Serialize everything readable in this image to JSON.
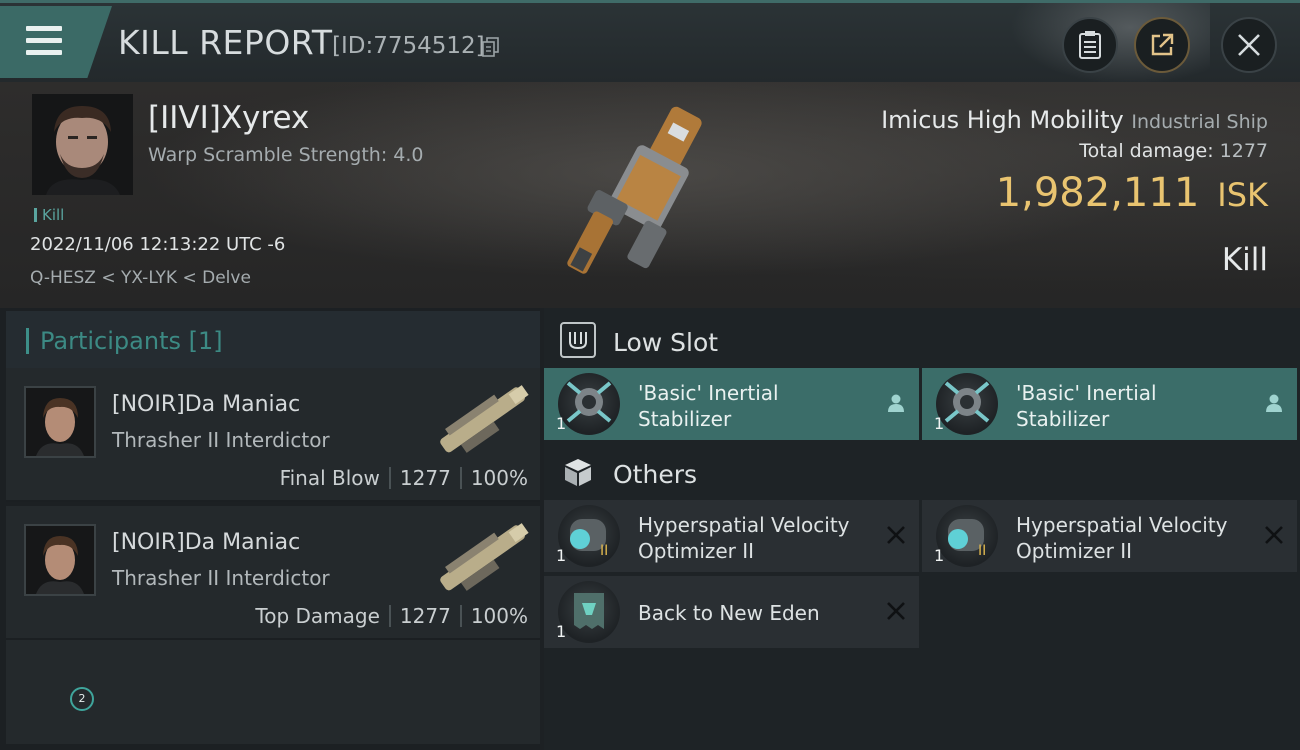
{
  "header": {
    "title": "KILL REPORT",
    "report_id": "[ID:7754512]"
  },
  "victim": {
    "pilot_name": "[IIVI]Xyrex",
    "warp_scramble": "Warp Scramble Strength: 4.0",
    "tag": "Kill",
    "datetime": "2022/11/06 12:13:22 UTC -6",
    "location": "Q-HESZ < YX-LYK < Delve",
    "ship_name": "Imicus High Mobility",
    "ship_class": "Industrial Ship",
    "total_damage_label": "Total damage:",
    "total_damage": "1277",
    "isk_value": "1,982,111",
    "isk_unit": "ISK",
    "result": "Kill"
  },
  "participants": {
    "header": "Participants [1]",
    "rows": [
      {
        "name": "[NOIR]Da Maniac",
        "ship": "Thrasher II Interdictor",
        "role": "Final Blow",
        "damage": "1277",
        "percent": "100%"
      },
      {
        "name": "[NOIR]Da Maniac",
        "ship": "Thrasher II Interdictor",
        "role": "Top Damage",
        "damage": "1277",
        "percent": "100%"
      }
    ],
    "page": "2"
  },
  "sections": {
    "low_slot": "Low Slot",
    "others": "Others"
  },
  "modules": {
    "low": [
      {
        "name_l1": "'Basic' Inertial",
        "name_l2": "Stabilizer",
        "qty": "1",
        "status": "fitted"
      },
      {
        "name_l1": "'Basic' Inertial",
        "name_l2": "Stabilizer",
        "qty": "1",
        "status": "fitted"
      }
    ],
    "others": [
      {
        "name_l1": "Hyperspatial Velocity",
        "name_l2": "Optimizer II",
        "qty": "1",
        "status": "destroyed"
      },
      {
        "name_l1": "Hyperspatial Velocity",
        "name_l2": "Optimizer II",
        "qty": "1",
        "status": "destroyed"
      },
      {
        "name_l1": "Back to New Eden",
        "qty": "1",
        "status": "destroyed"
      }
    ]
  },
  "colors": {
    "accent": "#3b6d69",
    "isk": "#e9c470",
    "participants_header": "#3c8a84"
  }
}
